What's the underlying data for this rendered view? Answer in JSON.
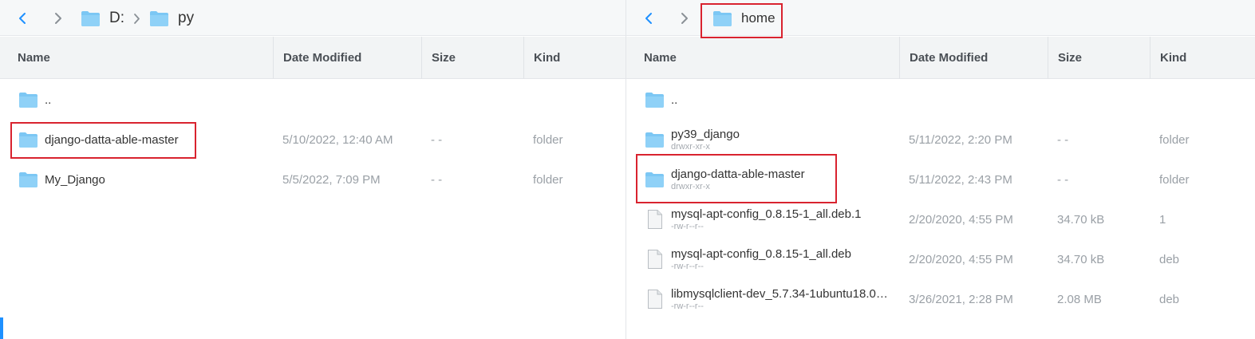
{
  "left_pane": {
    "breadcrumb": [
      {
        "label": "D:"
      },
      {
        "label": "py"
      }
    ],
    "columns": {
      "name": "Name",
      "date": "Date Modified",
      "size": "Size",
      "kind": "Kind"
    },
    "rows": [
      {
        "name": "..",
        "sub": "",
        "date": "",
        "size": "",
        "kind": "",
        "type": "folder"
      },
      {
        "name": "django-datta-able-master",
        "sub": "",
        "date": "5/10/2022, 12:40 AM",
        "size": "- -",
        "kind": "folder",
        "type": "folder"
      },
      {
        "name": "My_Django",
        "sub": "",
        "date": "5/5/2022, 7:09 PM",
        "size": "- -",
        "kind": "folder",
        "type": "folder"
      }
    ]
  },
  "right_pane": {
    "breadcrumb": [
      {
        "label": "home"
      }
    ],
    "columns": {
      "name": "Name",
      "date": "Date Modified",
      "size": "Size",
      "kind": "Kind"
    },
    "rows": [
      {
        "name": "..",
        "sub": "",
        "date": "",
        "size": "",
        "kind": "",
        "type": "folder"
      },
      {
        "name": "py39_django",
        "sub": "drwxr-xr-x",
        "date": "5/11/2022, 2:20 PM",
        "size": "- -",
        "kind": "folder",
        "type": "folder"
      },
      {
        "name": "django-datta-able-master",
        "sub": "drwxr-xr-x",
        "date": "5/11/2022, 2:43 PM",
        "size": "- -",
        "kind": "folder",
        "type": "folder"
      },
      {
        "name": "mysql-apt-config_0.8.15-1_all.deb.1",
        "sub": "-rw-r--r--",
        "date": "2/20/2020, 4:55 PM",
        "size": "34.70 kB",
        "kind": "1",
        "type": "file"
      },
      {
        "name": "mysql-apt-config_0.8.15-1_all.deb",
        "sub": "-rw-r--r--",
        "date": "2/20/2020, 4:55 PM",
        "size": "34.70 kB",
        "kind": "deb",
        "type": "file"
      },
      {
        "name": "libmysqlclient-dev_5.7.34-1ubuntu18.0…",
        "sub": "-rw-r--r--",
        "date": "3/26/2021, 2:28 PM",
        "size": "2.08 MB",
        "kind": "deb",
        "type": "file"
      }
    ]
  },
  "icons": {
    "back": "chevron-left-icon",
    "forward": "chevron-right-icon",
    "folder": "folder-icon",
    "file": "file-icon"
  },
  "colors": {
    "accent": "#1e90ff",
    "folder": "#7cc7f4",
    "highlight": "#d9232f"
  }
}
